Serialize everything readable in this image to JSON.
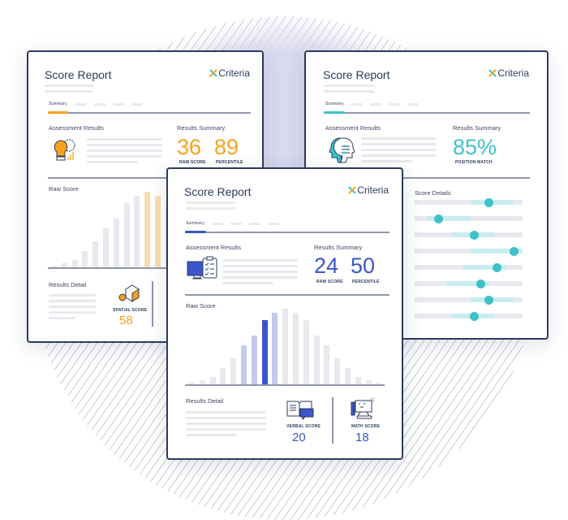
{
  "brand": "Criteria",
  "colors": {
    "navy": "#2d3a5e",
    "orange": "#f7a21b",
    "orange_light": "#f9dfb0",
    "blue": "#3a56c8",
    "blue_light": "#c5c9ee",
    "teal": "#3fc1c9",
    "teal_light": "#c8edf0",
    "gray": "#e8e9ee"
  },
  "left_card": {
    "title": "Score Report",
    "tab_active": "Summary",
    "assessment_label": "Assessment Results",
    "assessment_icon": "lightbulb-gear-icon",
    "summary_label": "Results Summary",
    "raw_score": "36",
    "raw_score_label": "RAW SCORE",
    "percentile": "89",
    "percentile_label": "PERCENTILE",
    "chart_label": "Raw Score",
    "highlight_bars": [
      9,
      10
    ],
    "detail_label": "Results Detail",
    "detail": {
      "icon": "cubes-gear-icon",
      "label": "SPATIAL SCORE",
      "value": "58"
    }
  },
  "front_card": {
    "title": "Score Report",
    "tab_active": "Summary",
    "assessment_label": "Assessment Results",
    "assessment_icon": "monitor-checklist-icon",
    "summary_label": "Results Summary",
    "raw_score": "24",
    "raw_score_label": "RAW SCORE",
    "percentile": "50",
    "percentile_label": "PERCENTILE",
    "chart_label": "Raw Score",
    "highlight_bars": [
      5,
      6,
      8
    ],
    "selected_bar": 7,
    "detail_label": "Results Detail",
    "details": [
      {
        "icon": "book-chat-icon",
        "label": "VERBAL SCORE",
        "value": "20"
      },
      {
        "icon": "whiteboard-math-icon",
        "label": "MATH SCORE",
        "value": "18"
      }
    ]
  },
  "right_card": {
    "title": "Score Report",
    "tab_active": "Summary",
    "assessment_label": "Assessment Results",
    "assessment_icon": "heads-sliders-icon",
    "summary_label": "Results Summary",
    "match": "85%",
    "match_label": "POSITION MATCH",
    "details_label": "Score Details",
    "score_rows": [
      {
        "band": [
          0.52,
          0.92
        ],
        "value": 0.69
      },
      {
        "band": [
          0.11,
          0.52
        ],
        "value": 0.22
      },
      {
        "band": [
          0.34,
          0.74
        ],
        "value": 0.55
      },
      {
        "band": [
          0.52,
          1.0
        ],
        "value": 0.92
      },
      {
        "band": [
          0.44,
          0.85
        ],
        "value": 0.76
      },
      {
        "band": [
          0.29,
          0.69
        ],
        "value": 0.61
      },
      {
        "band": [
          0.52,
          0.92
        ],
        "value": 0.69
      },
      {
        "band": [
          0.34,
          0.74
        ],
        "value": 0.55
      }
    ]
  },
  "distribution": [
    2,
    5,
    9,
    20,
    32,
    48,
    60,
    79,
    88,
    93,
    88,
    79,
    60,
    48,
    32,
    20,
    9,
    5,
    2
  ]
}
